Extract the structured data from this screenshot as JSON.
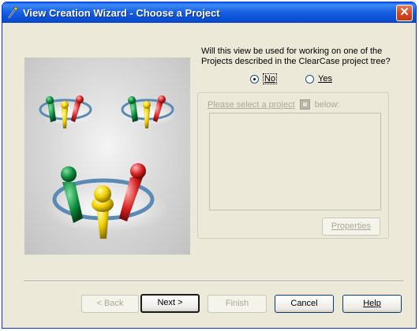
{
  "window": {
    "title": "View Creation Wizard - Choose a Project",
    "close_symbol": "✕",
    "icon": "wizard-wand-icon"
  },
  "question": {
    "text": "Will this view be used for working on one of the Projects described in the ClearCase project tree?"
  },
  "radios": [
    {
      "label": "No",
      "checked": true
    },
    {
      "label": "Yes",
      "checked": false
    }
  ],
  "project_group": {
    "label_prefix": "Please select a project",
    "label_suffix": "below:",
    "icon": "project-icon",
    "properties_label": "Properties"
  },
  "buttons": {
    "back": "< Back",
    "next": "Next >",
    "finish": "Finish",
    "cancel": "Cancel",
    "help": "Help"
  },
  "colors": {
    "titlebar": "#0b4fd4",
    "dialog_bg": "#ece9d8",
    "disabled_text": "#aca899"
  }
}
